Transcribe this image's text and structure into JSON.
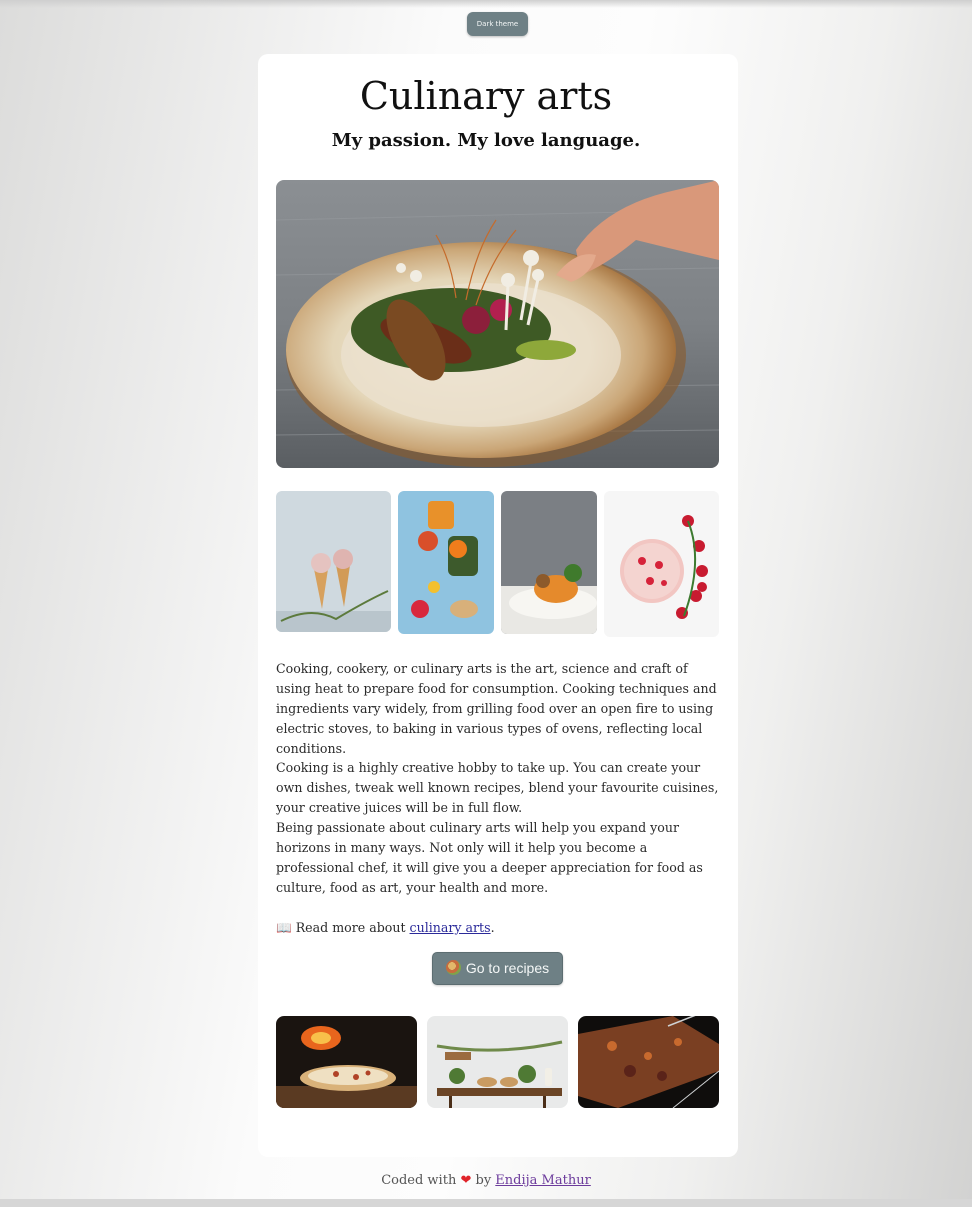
{
  "theme_button": {
    "label": "Dark theme"
  },
  "header": {
    "title": "Culinary arts",
    "subtitle": "My passion. My love language."
  },
  "images": {
    "hero": "plated-dish-photo",
    "gallery": [
      "ice-cream-cones-photo",
      "fruit-drinks-photo",
      "plated-meal-photo",
      "strawberry-bowl-photo"
    ],
    "bottom": [
      "wood-fired-pizza-photo",
      "table-spread-photo",
      "spices-board-photo"
    ]
  },
  "body": {
    "paragraphs": [
      "Cooking, cookery, or culinary arts is the art, science and craft of using heat to prepare food for consumption. Cooking techniques and ingredients vary widely, from grilling food over an open fire to using electric stoves, to baking in various types of ovens, reflecting local conditions.",
      "Cooking is a highly creative hobby to take up. You can create your own dishes, tweak well known recipes, blend your favourite cuisines, your creative juices will be in full flow.",
      "Being passionate about culinary arts will help you expand your horizons in many ways. Not only will it help you become a professional chef, it will give you a deeper appreciation for food as culture, food as art, your health and more."
    ],
    "read_more": {
      "icon": "📖",
      "prefix": "Read more about ",
      "link_text": "culinary arts",
      "suffix": "."
    }
  },
  "recipes_button": {
    "icon": "food-bowl-icon",
    "label": "Go to recipes"
  },
  "footer": {
    "prefix": "Coded with ",
    "heart": "❤",
    "middle": " by ",
    "author": "Endija Mathur"
  },
  "colors": {
    "button_bg": "#6e8085",
    "link": "#2b2a9a",
    "author_link": "#6c3b9c",
    "heart": "#e0242a"
  }
}
